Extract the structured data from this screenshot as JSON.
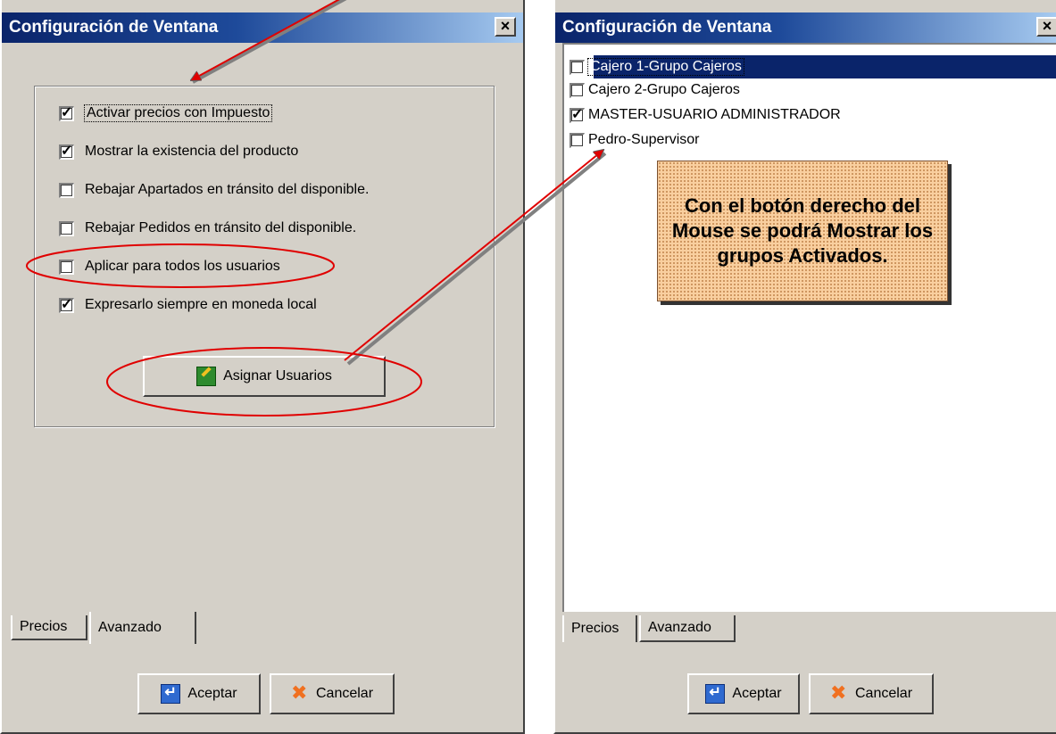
{
  "left_window": {
    "title": "Configuración de Ventana",
    "close_label": "×",
    "checkboxes": [
      {
        "label": "Activar precios con Impuesto",
        "checked": true,
        "focused": true
      },
      {
        "label": "Mostrar la existencia del producto",
        "checked": true
      },
      {
        "label": "Rebajar Apartados  en tránsito del disponible.",
        "checked": false
      },
      {
        "label": "Rebajar Pedidos  en tránsito del disponible.",
        "checked": false
      },
      {
        "label": "Aplicar para todos los usuarios",
        "checked": false,
        "circled": true
      },
      {
        "label": "Expresarlo siempre en moneda local",
        "checked": true
      }
    ],
    "assign_button": "Asignar Usuarios",
    "tabs": [
      {
        "label": "Precios",
        "active": false
      },
      {
        "label": "Avanzado",
        "active": true
      }
    ],
    "accept_button": "Aceptar",
    "cancel_button": "Cancelar"
  },
  "right_window": {
    "title": "Configuración de Ventana",
    "close_label": "×",
    "users": [
      {
        "label": "Cajero 1-Grupo Cajeros",
        "checked": false,
        "selected": true
      },
      {
        "label": "Cajero 2-Grupo Cajeros",
        "checked": false
      },
      {
        "label": "MASTER-USUARIO ADMINISTRADOR",
        "checked": true
      },
      {
        "label": "Pedro-Supervisor",
        "checked": false
      }
    ],
    "tabs": [
      {
        "label": "Precios",
        "active": false
      },
      {
        "label": "Avanzado",
        "active": true
      }
    ],
    "accept_button": "Aceptar",
    "cancel_button": "Cancelar"
  },
  "callout": {
    "text": "Con el botón derecho del Mouse se podrá Mostrar los grupos Activados."
  },
  "colors": {
    "title_bar": "#0a246a",
    "annotation_red": "#e00000",
    "callout_bg": "#f9cf9f"
  },
  "icons": {
    "assign": "pencil-user-icon",
    "accept": "enter-arrow-icon",
    "cancel": "x-icon"
  }
}
